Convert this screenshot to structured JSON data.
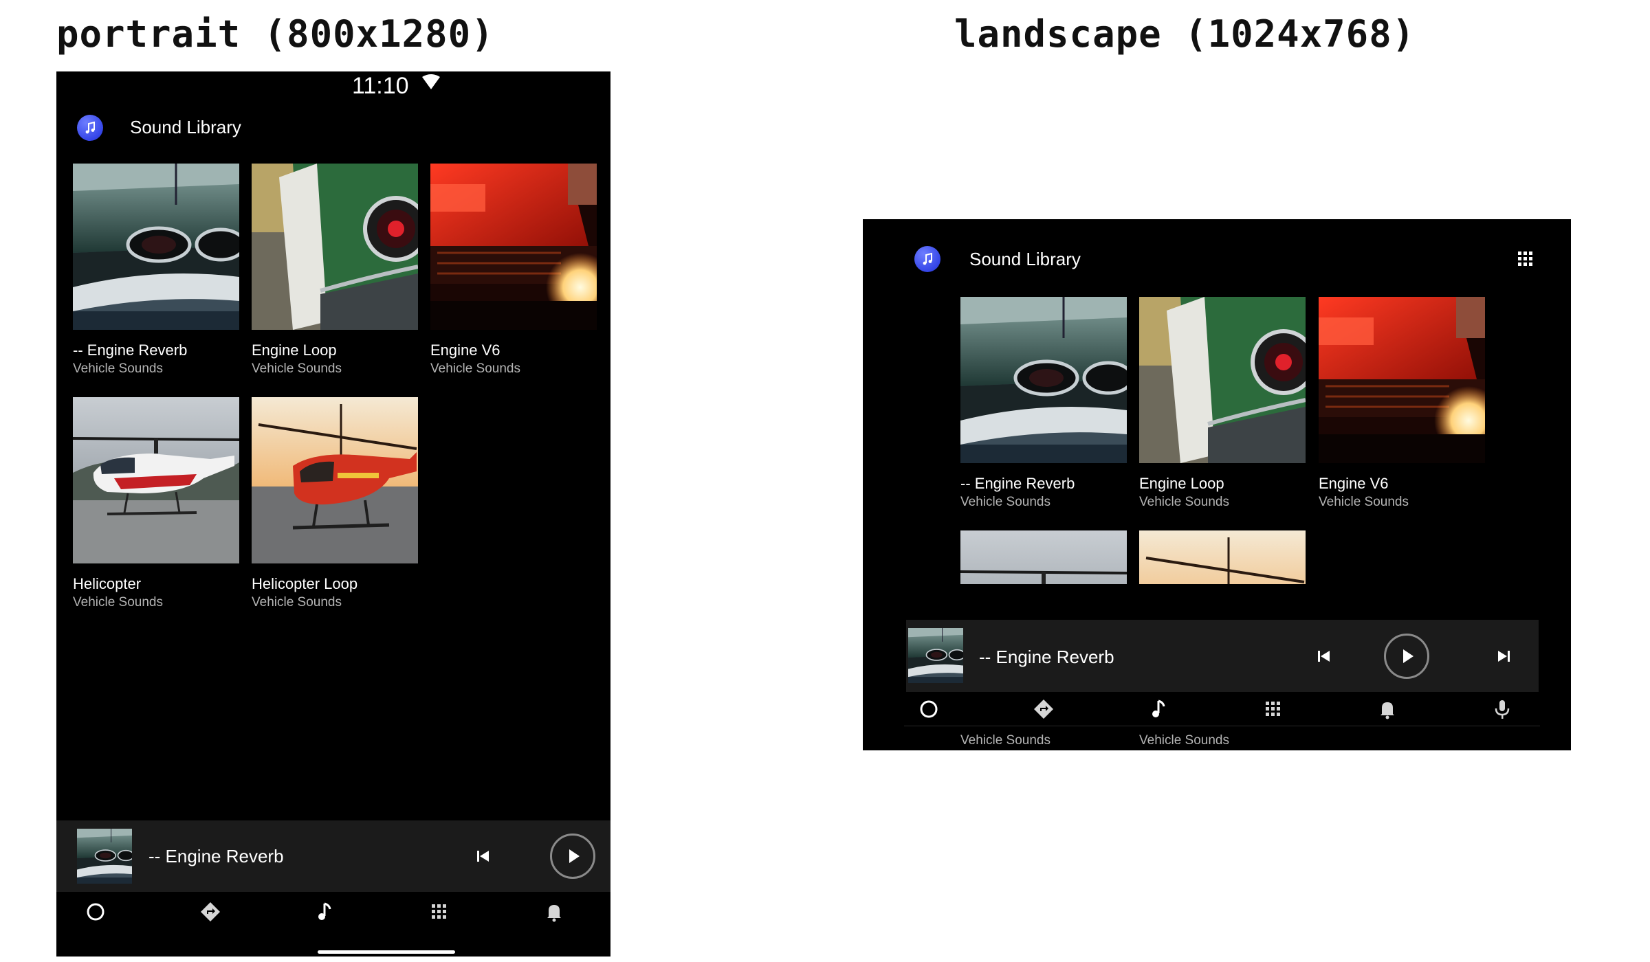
{
  "headings": {
    "portrait": "portrait (800x1280)",
    "landscape": "landscape (1024x768)"
  },
  "status_bar": {
    "time": "11:10"
  },
  "app": {
    "title": "Sound Library",
    "icon": "music-note-icon"
  },
  "tiles": [
    {
      "title": "-- Engine Reverb",
      "subtitle": "Vehicle Sounds",
      "image": "car-rear-green"
    },
    {
      "title": "Engine Loop",
      "subtitle": "Vehicle Sounds",
      "image": "car-taillight-green"
    },
    {
      "title": "Engine V6",
      "subtitle": "Vehicle Sounds",
      "image": "car-red-exhaust-flame"
    },
    {
      "title": "Helicopter",
      "subtitle": "Vehicle Sounds",
      "image": "helicopter-red-white"
    },
    {
      "title": "Helicopter Loop",
      "subtitle": "Vehicle Sounds",
      "image": "helicopter-red-sunset"
    }
  ],
  "now_playing": {
    "title": "-- Engine Reverb"
  },
  "nav": [
    "home-circle-icon",
    "navigation-icon",
    "music-note-icon",
    "apps-grid-icon",
    "notifications-bell-icon",
    "microphone-icon"
  ],
  "colors": {
    "background": "#000000",
    "surface": "#1b1b1b",
    "accent": "#3546e8",
    "secondary_text": "#b4b4b4"
  }
}
